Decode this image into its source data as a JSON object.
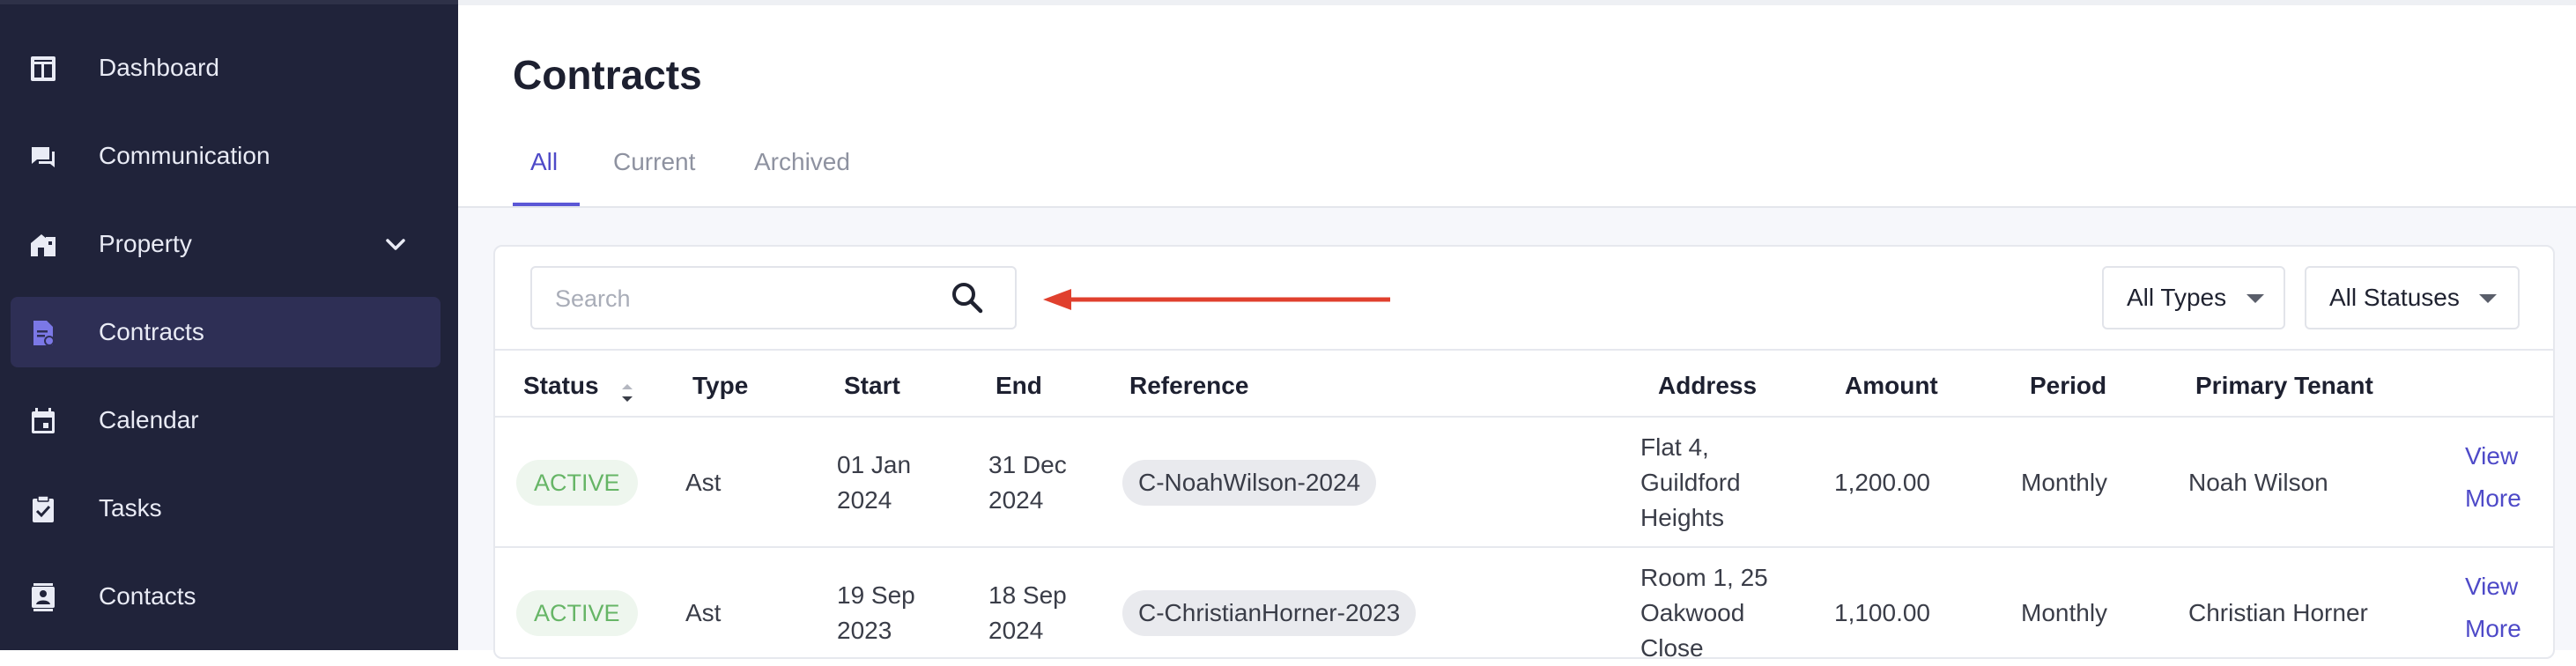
{
  "sidebar": {
    "items": [
      {
        "label": "Dashboard",
        "icon": "dashboard-icon"
      },
      {
        "label": "Communication",
        "icon": "chat-icon"
      },
      {
        "label": "Property",
        "icon": "property-icon"
      },
      {
        "label": "Contracts",
        "icon": "contract-icon"
      },
      {
        "label": "Calendar",
        "icon": "calendar-icon"
      },
      {
        "label": "Tasks",
        "icon": "tasks-icon"
      },
      {
        "label": "Contacts",
        "icon": "contacts-icon"
      }
    ],
    "active_item": "Contracts",
    "colors": {
      "background": "#20233a",
      "active": "#2e2f55",
      "active_icon": "#7b78e6"
    }
  },
  "main": {
    "title": "Contracts",
    "tabs": [
      {
        "label": "All",
        "active": true
      },
      {
        "label": "Current",
        "active": false
      },
      {
        "label": "Archived",
        "active": false
      }
    ],
    "accent": "#5b57d6"
  },
  "filters": {
    "search_placeholder": "Search",
    "type_select": "All Types",
    "status_select": "All Statuses"
  },
  "table": {
    "columns": [
      "Status",
      "Type",
      "Start",
      "End",
      "Reference",
      "Address",
      "Amount",
      "Period",
      "Primary Tenant"
    ],
    "rows": [
      {
        "status": "ACTIVE",
        "type": "Ast",
        "start_line1": "01 Jan",
        "start_line2": "2024",
        "end_line1": "31 Dec",
        "end_line2": "2024",
        "reference": "C-NoahWilson-2024",
        "address_line1": "Flat 4,",
        "address_line2": "Guildford",
        "address_line3": "Heights",
        "amount": "1,200.00",
        "period": "Monthly",
        "tenant": "Noah Wilson",
        "action_line1": "View",
        "action_line2": "More"
      },
      {
        "status": "ACTIVE",
        "type": "Ast",
        "start_line1": "19 Sep",
        "start_line2": "2023",
        "end_line1": "18 Sep",
        "end_line2": "2024",
        "reference": "C-ChristianHorner-2023",
        "address_line1": "Room 1, 25",
        "address_line2": "Oakwood",
        "address_line3": "Close",
        "amount": "1,100.00",
        "period": "Monthly",
        "tenant": "Christian Horner",
        "action_line1": "View",
        "action_line2": "More"
      }
    ]
  },
  "annotation": {
    "arrow_color": "#e0402e"
  }
}
